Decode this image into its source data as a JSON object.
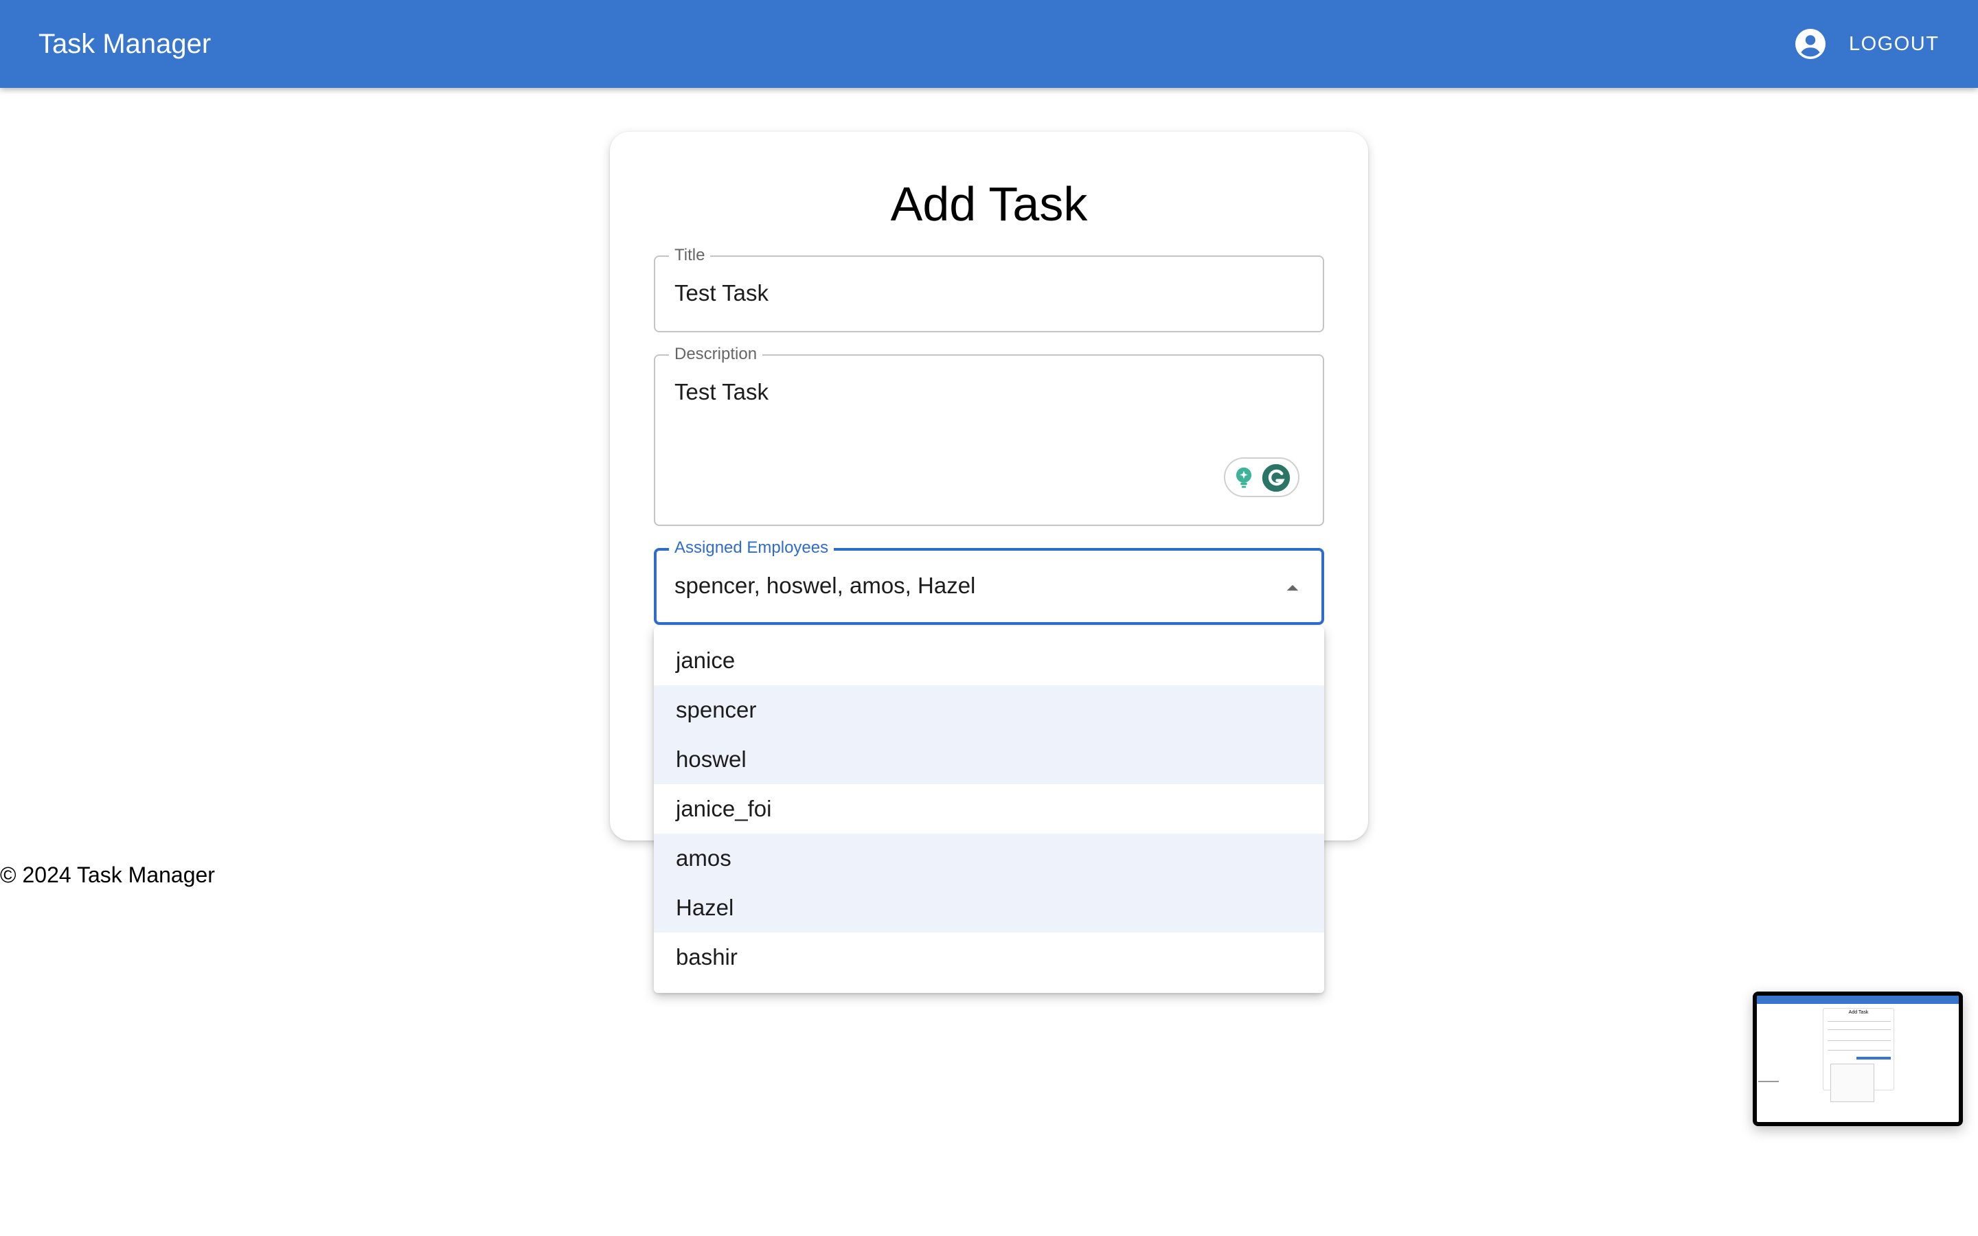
{
  "appbar": {
    "title": "Task Manager",
    "logout_label": "LOGOUT",
    "account_icon": "account-circle-icon",
    "color": "#3875cd"
  },
  "form": {
    "heading": "Add Task",
    "title_field": {
      "label": "Title",
      "value": "Test Task"
    },
    "description_field": {
      "label": "Description",
      "value": "Test Task"
    },
    "assigned_field": {
      "label": "Assigned Employees",
      "value": "spencer, hoswel, amos, Hazel",
      "caret_icon": "arrow-up-icon",
      "accent": "#2f6ccb"
    }
  },
  "employee_options": [
    {
      "label": "janice",
      "selected": false
    },
    {
      "label": "spencer",
      "selected": true
    },
    {
      "label": "hoswel",
      "selected": true
    },
    {
      "label": "janice_foi",
      "selected": false
    },
    {
      "label": "amos",
      "selected": true
    },
    {
      "label": "Hazel",
      "selected": true
    },
    {
      "label": "bashir",
      "selected": false
    }
  ],
  "footer": {
    "text": "© 2024 Task Manager"
  },
  "extensions": {
    "grammarly_icons": [
      "lightbulb-icon",
      "grammarly-g-icon"
    ]
  },
  "thumbnail": {
    "heading": "Add Task"
  }
}
